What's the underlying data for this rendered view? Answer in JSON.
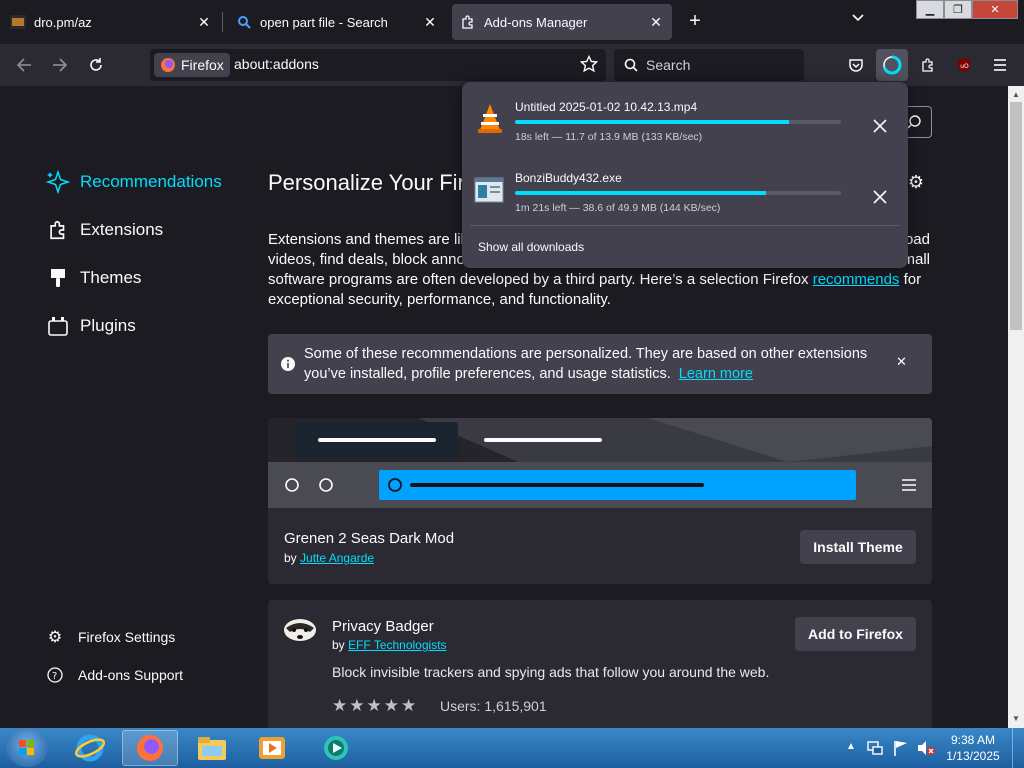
{
  "tabs": [
    {
      "title": "dro.pm/az",
      "icon": "site-favicon"
    },
    {
      "title": "open part file - Search",
      "icon": "search-icon"
    },
    {
      "title": "Add-ons Manager",
      "icon": "puzzle-icon",
      "active": true
    }
  ],
  "navbar": {
    "identity_label": "Firefox",
    "url": "about:addons",
    "search_placeholder": "Search"
  },
  "sidebar": {
    "items": [
      {
        "label": "Recommendations",
        "icon": "sparkle-icon",
        "selected": true
      },
      {
        "label": "Extensions",
        "icon": "puzzle-icon"
      },
      {
        "label": "Themes",
        "icon": "brush-icon"
      },
      {
        "label": "Plugins",
        "icon": "plugin-icon"
      }
    ],
    "footer": [
      {
        "label": "Firefox Settings",
        "icon": "gear-icon"
      },
      {
        "label": "Add-ons Support",
        "icon": "help-icon"
      }
    ]
  },
  "main": {
    "heading": "Personalize Your Firef",
    "intro_lines": [
      "Extensions and themes are lik",
      "videos, find deals, block anno",
      "software programs are often developed by a third party. Here’s a selection Firefox ",
      "exceptional security, performance, and functionality."
    ],
    "intro_right": [
      "oad",
      "mall"
    ],
    "intro_link": "recommends",
    "intro_after_link": " for",
    "notice": {
      "line1": "Some of these recommendations are personalized. They are based on other extensions",
      "line2": "you’ve installed, profile preferences, and usage statistics.",
      "link": "Learn more"
    },
    "theme_card": {
      "name": "Grenen 2 Seas Dark Mod",
      "by": "by",
      "author": "Jutte Angarde",
      "button": "Install Theme",
      "accent": "#00a2ff"
    },
    "addon_card": {
      "name": "Privacy Badger",
      "by": "by",
      "author": "EFF Technologists",
      "description": "Block invisible trackers and spying ads that follow you around the web.",
      "rating": 5,
      "users": "Users: 1,615,901",
      "button": "Add to Firefox"
    }
  },
  "downloads": {
    "items": [
      {
        "name": "Untitled 2025-01-02 10.42.13.mp4",
        "status": "18s left — 11.7 of 13.9 MB (133 KB/sec)",
        "progress": 0.84,
        "icon": "vlc-icon"
      },
      {
        "name": "BonziBuddy432.exe",
        "status": "1m 21s left — 38.6 of 49.9 MB (144 KB/sec)",
        "progress": 0.77,
        "icon": "exe-icon"
      }
    ],
    "show_all": "Show all downloads"
  },
  "taskbar": {
    "time": "9:38 AM",
    "date": "1/13/2025"
  },
  "colors": {
    "accent": "#00ddff",
    "surface": "#42414d",
    "bg": "#1c1b22"
  }
}
